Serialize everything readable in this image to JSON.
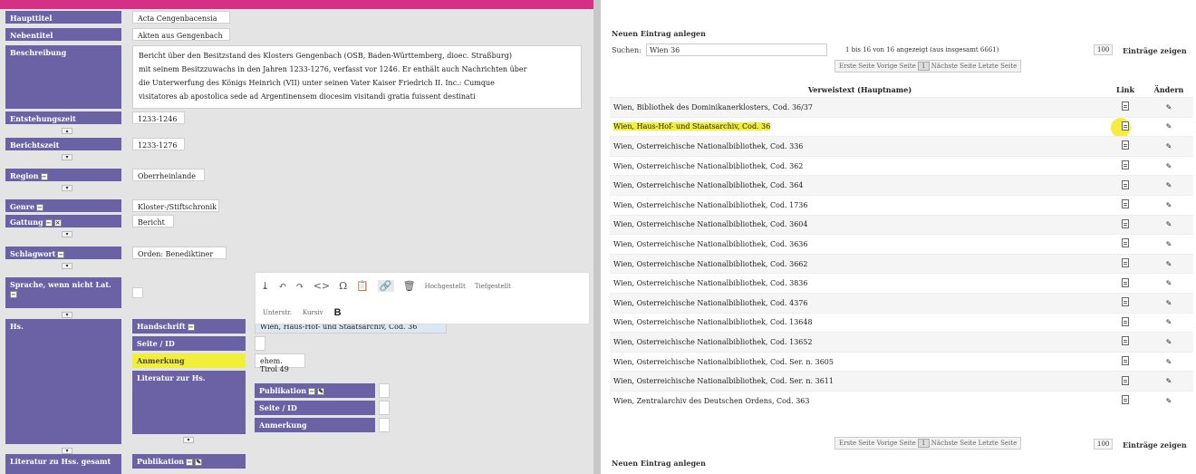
{
  "left": {
    "fields": [
      {
        "label": "Haupttitel",
        "value": "Acta Cengenbacensia"
      },
      {
        "label": "Nebentitel",
        "value": "Akten aus Gengenbach"
      },
      {
        "label": "Beschreibung",
        "value_lines": [
          "Bericht über den Besitzstand des Klosters Gengenbach (OSB, Baden-Württemberg, dioec. Straßburg)",
          "mit seinem Besitzzuwachs in den Jahren 1233-1276, verfasst vor 1246. Er enthält auch Nachrichten über",
          "die Unterwerfung des Königs Heinrich (VII) unter seinen Vater Kaiser Friedrich II. Inc.: Cumque",
          "visitatores ab apostolica sede ad Argentinensem diocesim visitandi gratia fuissent destinati"
        ]
      },
      {
        "label": "Entstehungszeit",
        "value": "1233-1246"
      },
      {
        "label": "Berichtszeit",
        "value": "1233-1276"
      },
      {
        "label": "Region",
        "value": "Oberrheinlande"
      },
      {
        "label": "Genre",
        "value": "Kloster-/Stiftschronik"
      },
      {
        "label": "Gattung",
        "value": "Bericht"
      },
      {
        "label": "Schlagwort",
        "value": "Orden: Benediktiner"
      },
      {
        "label": "Sprache, wenn nicht Lat.",
        "value": ""
      },
      {
        "label": "Hs.",
        "value": ""
      },
      {
        "label": "Literatur zu Hss. gesamt",
        "value": ""
      }
    ],
    "hs": {
      "handschrift_label": "Handschrift",
      "handschrift_value": "Wien, Haus-Hof- und Staatsarchiv, Cod. 36",
      "seite_label": "Seite / ID",
      "anmerkung_label": "Anmerkung",
      "anmerkung_value": "ehem. Tirol 49",
      "literatur_label": "Literatur zur Hs.",
      "publikation_label": "Publikation",
      "seite2_label": "Seite / ID",
      "anmerkung2_label": "Anmerkung",
      "publikation2_label": "Publikation"
    },
    "toolbar": {
      "icons": [
        "upload-icon",
        "undo-icon",
        "redo-icon",
        "code-icon",
        "omega-icon",
        "paste-icon",
        "link-icon",
        "delete-icon"
      ],
      "glyphs": [
        "⤓",
        "↶",
        "↷",
        "<>",
        "Ω",
        "📋",
        "🔗",
        "🗑"
      ],
      "btn1": "Hochgestellt",
      "btn2": "Tiefgestellt",
      "btn3": "Unterstr.",
      "btn4": "Kursiv",
      "bold": "B"
    }
  },
  "right": {
    "new_entry_top": "Neuen Eintrag anlegen",
    "search_label": "Suchen:",
    "search_value": "Wien 36",
    "info_text": "1 bis 16 von 16 angezeigt (aus insgesamt 6661)",
    "page_size": "100",
    "entries_label": "Einträge zeigen",
    "pager": {
      "first": "Erste Seite",
      "prev": "Vorige Seite",
      "current": "1",
      "next": "Nächste Seite",
      "last": "Letzte Seite"
    },
    "columns": [
      "Verweistext (Hauptname)",
      "Link",
      "Ändern"
    ],
    "rows": [
      "Wien, Bibliothek des Dominikanerklosters, Cod. 36/37",
      "Wien, Haus-Hof- und Staatsarchiv, Cod. 36",
      "Wien, Österreichische Nationalbibliothek, Cod. 336",
      "Wien, Österreichische Nationalbibliothek, Cod. 362",
      "Wien, Österreichische Nationalbibliothek, Cod. 364",
      "Wien, Österreichische Nationalbibliothek, Cod. 1736",
      "Wien, Österreichische Nationalbibliothek, Cod. 3604",
      "Wien, Österreichische Nationalbibliothek, Cod. 3636",
      "Wien, Österreichische Nationalbibliothek, Cod. 3662",
      "Wien, Österreichische Nationalbibliothek, Cod. 3836",
      "Wien, Österreichische Nationalbibliothek, Cod. 4376",
      "Wien, Österreichische Nationalbibliothek, Cod. 13648",
      "Wien, Österreichische Nationalbibliothek, Cod. 13652",
      "Wien, Österreichische Nationalbibliothek, Cod. Ser. n. 3605",
      "Wien, Österreichische Nationalbibliothek, Cod. Ser. n. 3611",
      "Wien, Zentralarchiv des Deutschen Ordens, Cod. 363"
    ],
    "highlight_row": 1,
    "new_entry_bottom": "Neuen Eintrag anlegen",
    "colors": {
      "label_bg": "#6a62a4",
      "pink": "#d62f86",
      "highlight": "#f1ef3a"
    }
  }
}
